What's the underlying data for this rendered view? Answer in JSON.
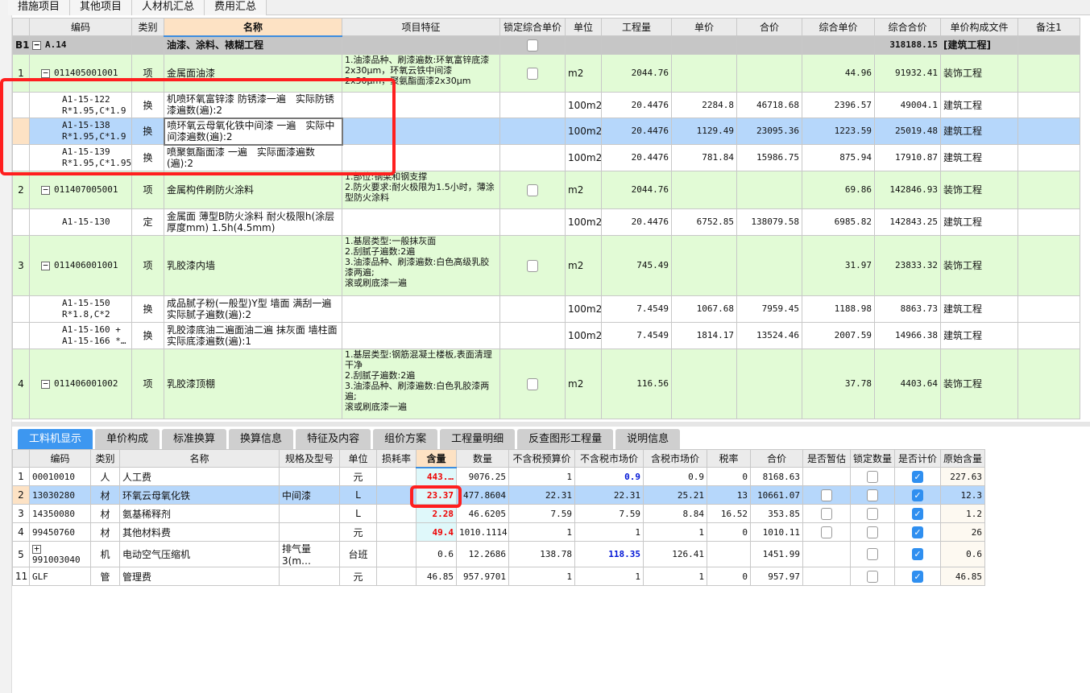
{
  "top_tabs": [
    "措施项目",
    "其他项目",
    "人材机汇总",
    "费用汇总"
  ],
  "upper": {
    "headers": [
      "",
      "编码",
      "类别",
      "名称",
      "项目特征",
      "锁定综合单价",
      "单位",
      "工程量",
      "单价",
      "合价",
      "综合单价",
      "综合合价",
      "单价构成文件",
      "备注1"
    ],
    "rows": [
      {
        "kind": "grp",
        "no": "B1",
        "code": "A.14",
        "type": "",
        "name": "油漆、涂料、裱糊工程",
        "feature": "",
        "lock": true,
        "unit": "",
        "qty": "",
        "price": "",
        "total": "",
        "cprice": "",
        "ctotal": "318188.15",
        "file": "[建筑工程]",
        "note": ""
      },
      {
        "kind": "item",
        "no": "1",
        "code": "011405001001",
        "type": "项",
        "name": "金属面油漆",
        "feature": "1.油漆品种、刷漆遍数:环氧富锌底漆2x30μm，环氧云铁中间漆2x30μm，聚氨酯面漆2x30μm",
        "lock": true,
        "unit": "m2",
        "qty": "2044.76",
        "price": "",
        "total": "",
        "cprice": "44.96",
        "ctotal": "91932.41",
        "file": "装饰工程",
        "note": ""
      },
      {
        "kind": "sub",
        "no": "",
        "code": "A1-15-122\nR*1.95,C*1.9",
        "type": "换",
        "name": "机喷环氧富锌漆 防锈漆一遍　实际防锈漆遍数(遍):2",
        "feature": "",
        "lock": false,
        "unit": "100m2",
        "qty": "20.4476",
        "price": "2284.8",
        "total": "46718.68",
        "cprice": "2396.57",
        "ctotal": "49004.1",
        "file": "建筑工程",
        "note": ""
      },
      {
        "kind": "sel",
        "no": "",
        "code": "A1-15-138\nR*1.95,C*1.9",
        "type": "换",
        "name": "喷环氧云母氧化铁中间漆 一遍　实际中间漆遍数(遍):2",
        "feature": "",
        "lock": false,
        "unit": "100m2",
        "qty": "20.4476",
        "price": "1129.49",
        "total": "23095.36",
        "cprice": "1223.59",
        "ctotal": "25019.48",
        "file": "建筑工程",
        "note": ""
      },
      {
        "kind": "sub",
        "no": "",
        "code": "A1-15-139\nR*1.95,C*1.95",
        "type": "换",
        "name": "喷聚氨酯面漆 一遍　实际面漆遍数(遍):2",
        "feature": "",
        "lock": false,
        "unit": "100m2",
        "qty": "20.4476",
        "price": "781.84",
        "total": "15986.75",
        "cprice": "875.94",
        "ctotal": "17910.87",
        "file": "建筑工程",
        "note": ""
      },
      {
        "kind": "item",
        "no": "2",
        "code": "011407005001",
        "type": "项",
        "name": "金属构件刷防火涂料",
        "feature": "1.部位:钢梁和钢支撑\n2.防火要求:耐火极限为1.5小时，薄涂型防火涂料",
        "lock": true,
        "unit": "m2",
        "qty": "2044.76",
        "price": "",
        "total": "",
        "cprice": "69.86",
        "ctotal": "142846.93",
        "file": "装饰工程",
        "note": ""
      },
      {
        "kind": "sub",
        "no": "",
        "code": "A1-15-130",
        "type": "定",
        "name": "金属面 薄型B防火涂料 耐火极限h(涂层厚度mm) 1.5h(4.5mm)",
        "feature": "",
        "lock": false,
        "unit": "100m2",
        "qty": "20.4476",
        "price": "6752.85",
        "total": "138079.58",
        "cprice": "6985.82",
        "ctotal": "142843.25",
        "file": "建筑工程",
        "note": ""
      },
      {
        "kind": "item",
        "no": "3",
        "code": "011406001001",
        "type": "项",
        "name": "乳胶漆内墙",
        "feature": "1.基层类型:一般抹灰面\n2.刮腻子遍数:2遍\n3.油漆品种、刷漆遍数:白色高级乳胶漆两遍;\n滚或刷底漆一遍",
        "lock": true,
        "unit": "m2",
        "qty": "745.49",
        "price": "",
        "total": "",
        "cprice": "31.97",
        "ctotal": "23833.32",
        "file": "装饰工程",
        "note": ""
      },
      {
        "kind": "sub",
        "no": "",
        "code": "A1-15-150\nR*1.8,C*2",
        "type": "换",
        "name": "成品腻子粉(一般型)Y型 墙面 满刮一遍　实际腻子遍数(遍):2",
        "feature": "",
        "lock": false,
        "unit": "100m2",
        "qty": "7.4549",
        "price": "1067.68",
        "total": "7959.45",
        "cprice": "1188.98",
        "ctotal": "8863.73",
        "file": "建筑工程",
        "note": ""
      },
      {
        "kind": "sub",
        "no": "",
        "code": "A1-15-160 +\nA1-15-166 *…",
        "type": "换",
        "name": "乳胶漆底油二遍面油二遍 抹灰面 墙柱面　实际底漆遍数(遍):1",
        "feature": "",
        "lock": false,
        "unit": "100m2",
        "qty": "7.4549",
        "price": "1814.17",
        "total": "13524.46",
        "cprice": "2007.59",
        "ctotal": "14966.38",
        "file": "建筑工程",
        "note": ""
      },
      {
        "kind": "item",
        "no": "4",
        "code": "011406001002",
        "type": "项",
        "name": "乳胶漆顶棚",
        "feature": "1.基层类型:钢筋混凝土楼板,表面清理干净\n2.刮腻子遍数:2遍\n3.油漆品种、刷漆遍数:白色乳胶漆两遍;\n滚或刷底漆一遍",
        "lock": true,
        "unit": "m2",
        "qty": "116.56",
        "price": "",
        "total": "",
        "cprice": "37.78",
        "ctotal": "4403.64",
        "file": "装饰工程",
        "note": ""
      }
    ]
  },
  "bottom_tabs": [
    "工料机显示",
    "单价构成",
    "标准换算",
    "换算信息",
    "特征及内容",
    "组价方案",
    "工程量明细",
    "反查图形工程量",
    "说明信息"
  ],
  "lower": {
    "headers": [
      "",
      "编码",
      "类别",
      "名称",
      "规格及型号",
      "单位",
      "损耗率",
      "含量",
      "数量",
      "不含税预算价",
      "不含税市场价",
      "含税市场价",
      "税率",
      "合价",
      "是否暂估",
      "锁定数量",
      "是否计价",
      "原始含量"
    ],
    "rows": [
      {
        "no": "1",
        "code": "00010010",
        "expand": false,
        "type": "人",
        "name": "人工费",
        "spec": "",
        "unit": "元",
        "loss": "",
        "content": "443.…",
        "content_red": true,
        "qty": "9076.25",
        "budget": "1",
        "market": "0.9",
        "market_blue": true,
        "taxmarket": "0.9",
        "tax": "0",
        "total": "8168.63",
        "est": null,
        "lockqty": false,
        "priced": true,
        "orig": "227.63"
      },
      {
        "no": "2",
        "code": "13030280",
        "expand": false,
        "type": "材",
        "name": "环氧云母氧化铁",
        "spec": "中间漆",
        "unit": "L",
        "loss": "",
        "content": "23.37",
        "content_red": true,
        "qty": "477.8604",
        "budget": "22.31",
        "market": "22.31",
        "market_blue": false,
        "taxmarket": "25.21",
        "tax": "13",
        "total": "10661.07",
        "est": false,
        "lockqty": false,
        "priced": true,
        "orig": "12.3"
      },
      {
        "no": "3",
        "code": "14350080",
        "expand": false,
        "type": "材",
        "name": "氨基稀释剂",
        "spec": "",
        "unit": "L",
        "loss": "",
        "content": "2.28",
        "content_red": true,
        "qty": "46.6205",
        "budget": "7.59",
        "market": "7.59",
        "market_blue": false,
        "taxmarket": "8.84",
        "tax": "16.52",
        "total": "353.85",
        "est": false,
        "lockqty": false,
        "priced": true,
        "orig": "1.2"
      },
      {
        "no": "4",
        "code": "99450760",
        "expand": false,
        "type": "材",
        "name": "其他材料费",
        "spec": "",
        "unit": "元",
        "loss": "",
        "content": "49.4",
        "content_red": true,
        "qty": "1010.1114",
        "budget": "1",
        "market": "1",
        "market_blue": false,
        "taxmarket": "1",
        "tax": "0",
        "total": "1010.11",
        "est": false,
        "lockqty": false,
        "priced": true,
        "orig": "26"
      },
      {
        "no": "5",
        "code": "991003040",
        "expand": true,
        "type": "机",
        "name": "电动空气压缩机",
        "spec": "排气量3(m…",
        "unit": "台班",
        "loss": "",
        "content": "0.6",
        "content_red": false,
        "qty": "12.2686",
        "budget": "138.78",
        "market": "118.35",
        "market_blue": true,
        "taxmarket": "126.41",
        "tax": "",
        "total": "1451.99",
        "est": null,
        "lockqty": false,
        "priced": true,
        "orig": "0.6"
      },
      {
        "no": "11",
        "code": "GLF",
        "expand": false,
        "type": "管",
        "name": "管理费",
        "spec": "",
        "unit": "元",
        "loss": "",
        "content": "46.85",
        "content_red": false,
        "qty": "957.9701",
        "budget": "1",
        "market": "1",
        "market_blue": false,
        "taxmarket": "1",
        "tax": "0",
        "total": "957.97",
        "est": null,
        "lockqty": false,
        "priced": true,
        "orig": "46.85"
      }
    ]
  },
  "colors": {
    "accent": "#3d97f0",
    "item_bg": "#e2fbd6",
    "selected_bg": "#b6d7fb",
    "highlight": "#ff1f1f"
  }
}
